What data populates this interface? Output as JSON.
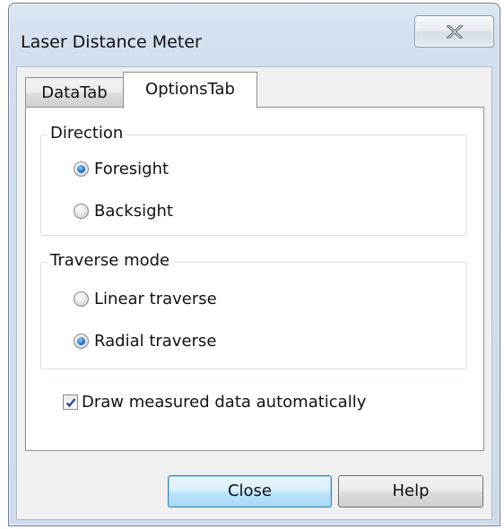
{
  "window": {
    "title": "Laser Distance Meter",
    "close_icon": "close-x-icon"
  },
  "tabs": [
    {
      "label": "DataTab",
      "active": false
    },
    {
      "label": "OptionsTab",
      "active": true
    }
  ],
  "direction": {
    "legend": "Direction",
    "options": [
      {
        "label": "Foresight",
        "checked": true
      },
      {
        "label": "Backsight",
        "checked": false
      }
    ]
  },
  "traverse_mode": {
    "legend": "Traverse mode",
    "options": [
      {
        "label": "Linear traverse",
        "checked": false
      },
      {
        "label": "Radial traverse",
        "checked": true
      }
    ]
  },
  "auto_draw": {
    "label": "Draw measured data automatically",
    "checked": true
  },
  "buttons": {
    "close_label": "Close",
    "help_label": "Help"
  },
  "colors": {
    "accent": "#2b79c4",
    "default_button": "#bee6fd"
  }
}
